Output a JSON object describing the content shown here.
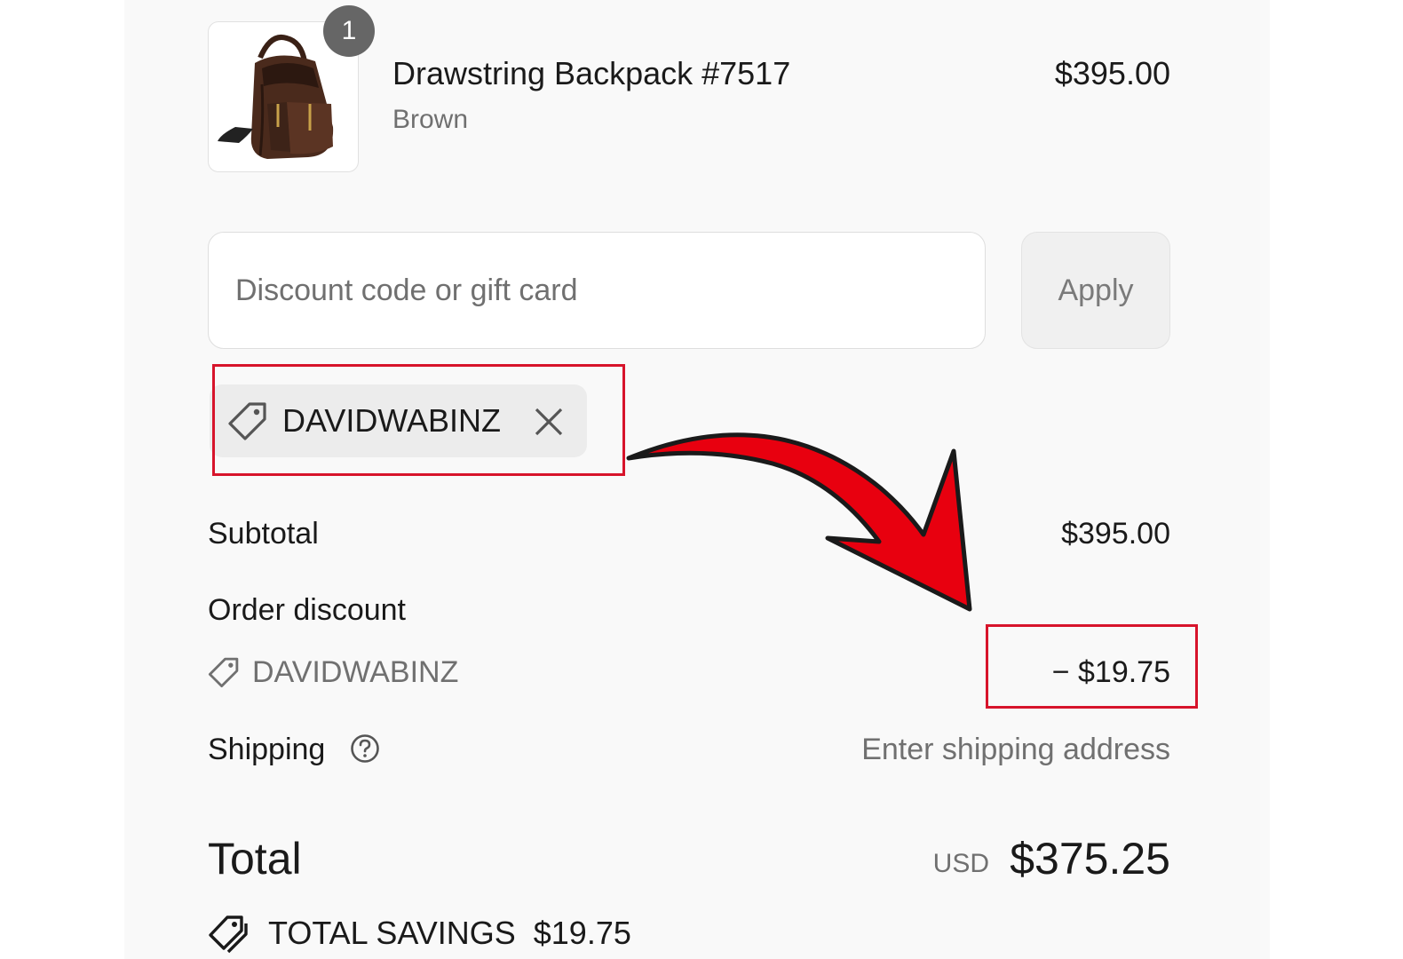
{
  "product": {
    "quantity_badge": "1",
    "title": "Drawstring Backpack #7517",
    "variant": "Brown",
    "price": "$395.00",
    "image_icon": "backpack-image"
  },
  "discount": {
    "placeholder": "Discount code or gift card",
    "apply_label": "Apply",
    "applied_code": "DAVIDWABINZ",
    "tag_icon": "tag-icon",
    "remove_icon": "close-icon"
  },
  "summary": {
    "subtotal_label": "Subtotal",
    "subtotal_value": "$395.00",
    "order_discount_label": "Order discount",
    "order_discount_code": "DAVIDWABINZ",
    "order_discount_value": "− $19.75",
    "shipping_label": "Shipping",
    "shipping_value": "Enter shipping address",
    "total_label": "Total",
    "currency": "USD",
    "total_value": "$375.25",
    "savings_label": "TOTAL SAVINGS",
    "savings_value": "$19.75"
  },
  "annotations": {
    "highlight_color": "#d7142b",
    "arrow_color": "#e8000f"
  }
}
